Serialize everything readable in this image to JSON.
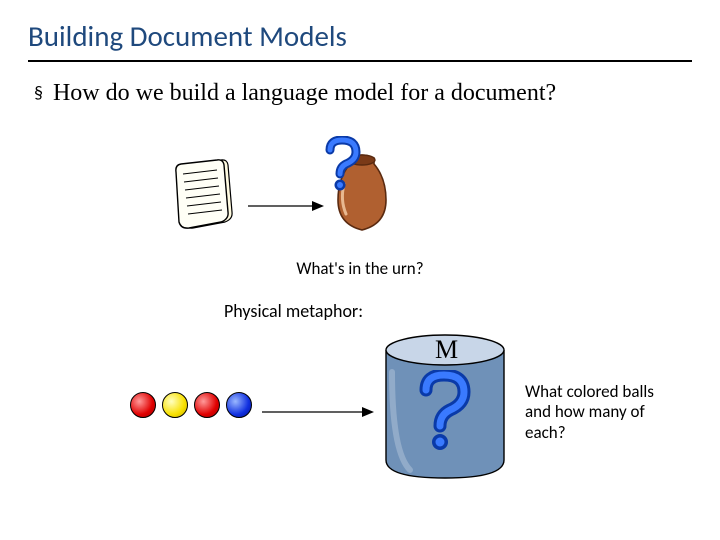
{
  "title": "Building Document Models",
  "bullet": "How do we build a language model for a document?",
  "caption_urn": "What's in the urn?",
  "caption_metaphor": "Physical metaphor:",
  "cylinder_label": "M",
  "side_question": "What colored balls and how many of each?",
  "balls": [
    "red",
    "yellow",
    "red",
    "blue"
  ],
  "icons": {
    "document": "document-icon",
    "urn": "urn-icon",
    "question": "question-icon",
    "cylinder": "cylinder-icon",
    "arrow": "arrow-icon"
  }
}
